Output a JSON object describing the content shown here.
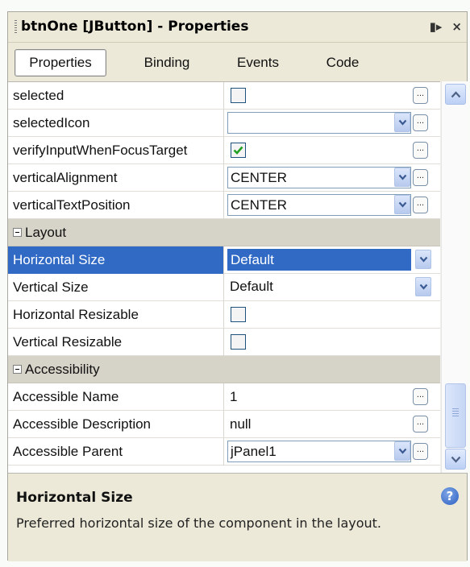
{
  "window": {
    "title": "btnOne [JButton] - Properties",
    "dock_glyph": "▮▸",
    "close_glyph": "×"
  },
  "tabs": [
    "Properties",
    "Binding",
    "Events",
    "Code"
  ],
  "active_tab": "Properties",
  "rows": [
    {
      "name": "selected",
      "kind": "checkbox",
      "checked": false,
      "ellipsis": true
    },
    {
      "name": "selectedIcon",
      "kind": "combo",
      "value": "",
      "dropdown": true,
      "ellipsis": true
    },
    {
      "name": "verifyInputWhenFocusTarget",
      "kind": "checkbox",
      "checked": true,
      "ellipsis": true
    },
    {
      "name": "verticalAlignment",
      "kind": "combo",
      "value": "CENTER",
      "dropdown": true,
      "ellipsis": true
    },
    {
      "name": "verticalTextPosition",
      "kind": "combo",
      "value": "CENTER",
      "dropdown": true,
      "ellipsis": true
    },
    {
      "category": "Layout"
    },
    {
      "name": "Horizontal Size",
      "kind": "combo",
      "value": "Default",
      "dropdown": true,
      "selected": true
    },
    {
      "name": "Vertical Size",
      "kind": "combo",
      "value": "Default",
      "dropdown": true,
      "plain": true
    },
    {
      "name": "Horizontal Resizable",
      "kind": "checkbox",
      "checked": false
    },
    {
      "name": "Vertical Resizable",
      "kind": "checkbox",
      "checked": false
    },
    {
      "category": "Accessibility"
    },
    {
      "name": "Accessible Name",
      "kind": "text",
      "value": "1",
      "ellipsis": true
    },
    {
      "name": "Accessible Description",
      "kind": "text",
      "value": "null",
      "ellipsis": true
    },
    {
      "name": "Accessible Parent",
      "kind": "combo",
      "value": "jPanel1",
      "dropdown": true,
      "ellipsis": true
    }
  ],
  "ellipsis_label": "...",
  "description": {
    "title": "Horizontal Size",
    "text": "Preferred horizontal size of the component in the layout.",
    "help_glyph": "?"
  },
  "colors": {
    "selection": "#316ac5",
    "category_bg": "#d6d3c8",
    "panel_bg": "#ece9d8"
  },
  "icons": [
    "dock-icon",
    "close-icon",
    "collapse-icon",
    "dropdown-arrow-icon",
    "ellipsis-icon",
    "check-icon",
    "scroll-up-icon",
    "scroll-down-icon",
    "help-icon"
  ]
}
